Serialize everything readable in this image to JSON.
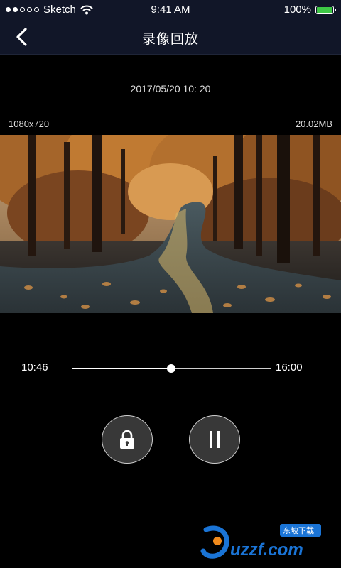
{
  "status_bar": {
    "carrier": "Sketch",
    "time": "9:41 AM",
    "battery_percent": "100%",
    "battery_level": 1.0
  },
  "nav": {
    "title": "录像回放"
  },
  "recording": {
    "timestamp": "2017/05/20 10: 20",
    "resolution": "1080x720",
    "file_size": "20.02MB"
  },
  "playback": {
    "current_time": "10:46",
    "total_time": "16:00",
    "progress": 0.5
  },
  "colors": {
    "nav_bg": "#111628",
    "battery_green": "#3ec846",
    "watermark_blue": "#1a74d6",
    "watermark_orange": "#f08a1c"
  },
  "icons": {
    "back": "chevron-left-icon",
    "lock": "lock-icon",
    "pause": "pause-icon"
  },
  "watermark": {
    "text": "uzzf.com",
    "badge": "东坡下载"
  }
}
